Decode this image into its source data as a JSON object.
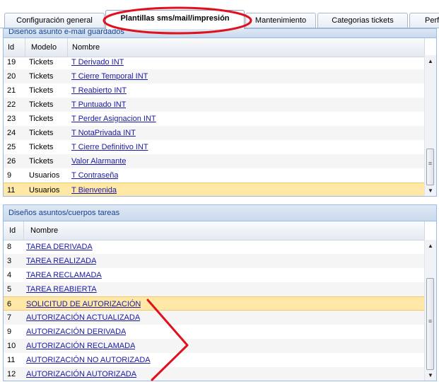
{
  "tabs": [
    {
      "label": "Configuración general",
      "active": false
    },
    {
      "label": "Plantillas sms/mail/impresión",
      "active": true
    },
    {
      "label": "Mantenimiento",
      "active": false
    },
    {
      "label": "Categorias tickets",
      "active": false
    },
    {
      "label": "Perf",
      "active": false
    }
  ],
  "email_panel": {
    "title": "Diseños asunto e-mail guardados",
    "columns": [
      "Id",
      "Modelo",
      "Nombre"
    ],
    "rows": [
      {
        "id": "19",
        "modelo": "Tickets",
        "nombre": "T Derivado INT"
      },
      {
        "id": "20",
        "modelo": "Tickets",
        "nombre": "T Cierre Temporal INT"
      },
      {
        "id": "21",
        "modelo": "Tickets",
        "nombre": "T Reabierto INT"
      },
      {
        "id": "22",
        "modelo": "Tickets",
        "nombre": "T Puntuado INT"
      },
      {
        "id": "23",
        "modelo": "Tickets",
        "nombre": "T Perder Asignacion INT"
      },
      {
        "id": "24",
        "modelo": "Tickets",
        "nombre": "T NotaPrivada INT"
      },
      {
        "id": "25",
        "modelo": "Tickets",
        "nombre": "T Cierre Definitivo INT"
      },
      {
        "id": "26",
        "modelo": "Tickets",
        "nombre": "Valor Alarmante"
      },
      {
        "id": "9",
        "modelo": "Usuarios",
        "nombre": "T Contraseña"
      },
      {
        "id": "11",
        "modelo": "Usuarios",
        "nombre": "T Bienvenida",
        "selected": true
      }
    ]
  },
  "tasks_panel": {
    "title": "Diseños asuntos/cuerpos tareas",
    "columns": [
      "Id",
      "Nombre"
    ],
    "rows": [
      {
        "id": "8",
        "nombre": "TAREA DERIVADA"
      },
      {
        "id": "3",
        "nombre": "TAREA REALIZADA"
      },
      {
        "id": "4",
        "nombre": "TAREA RECLAMADA"
      },
      {
        "id": "5",
        "nombre": "TAREA REABIERTA"
      },
      {
        "id": "6",
        "nombre": "SOLICITUD DE AUTORIZACIÓN",
        "selected": true
      },
      {
        "id": "7",
        "nombre": "AUTORIZACIÓN ACTUALIZADA"
      },
      {
        "id": "9",
        "nombre": "AUTORIZACIÓN DERIVADA"
      },
      {
        "id": "10",
        "nombre": "AUTORIZACIÓN RECLAMADA"
      },
      {
        "id": "11",
        "nombre": "AUTORIZACIÓN NO AUTORIZADA"
      },
      {
        "id": "12",
        "nombre": "AUTORIZACIÓN AUTORIZADA"
      }
    ]
  },
  "icons": {
    "scroll_up": "scroll-up-icon",
    "scroll_down": "scroll-down-icon",
    "scroll_grip": "grip-icon"
  },
  "colors": {
    "highlight_ring": "#e0101e",
    "selected_row": "#ffe8a6",
    "link": "#1a1aa6",
    "panel_title": "#15428b"
  }
}
